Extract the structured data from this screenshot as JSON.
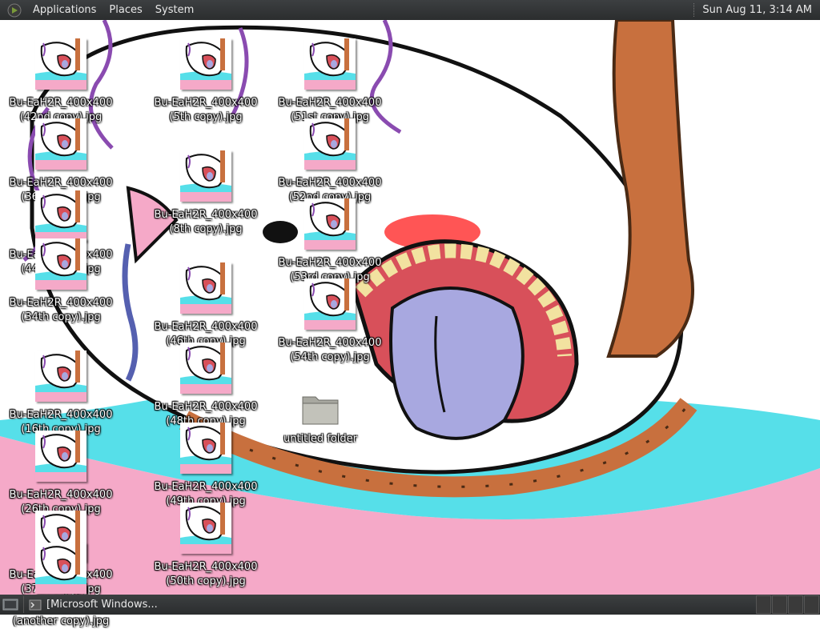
{
  "top_panel": {
    "menus": [
      "Applications",
      "Places",
      "System"
    ],
    "clock": "Sun Aug 11,  3:14 AM"
  },
  "bottom_panel": {
    "task_label": "[Microsoft Windows..."
  },
  "desktop": {
    "left_icons": [
      {
        "line1": "Bu-EaH2R_400x400",
        "line2": "(42nd copy).jpg"
      },
      {
        "line1": "Bu-EaH2R_400x400",
        "line2": "(36th copy).jpg"
      },
      {
        "line1": "Bu-EaH2R_400x400",
        "line2": "(44th copy).jpg"
      },
      {
        "line1": "Bu-EaH2R_400x400",
        "line2": "(34th copy).jpg"
      },
      {
        "line1": "Bu-EaH2R_400x400",
        "line2": "(16th copy).jpg"
      },
      {
        "line1": "Bu-EaH2R_400x400",
        "line2": "(26th copy).jpg"
      },
      {
        "line1": "Bu-EaH2R_400x400",
        "line2": "(37th copy).jpg"
      },
      {
        "line1": "Bu-EaH2R_400x400",
        "line2": "(another copy).jpg"
      }
    ],
    "middle_icons": [
      {
        "line1": "Bu-EaH2R_400x400",
        "line2": "(5th copy).jpg"
      },
      {
        "line1": "Bu-EaH2R_400x400",
        "line2": "(8th copy).jpg"
      },
      {
        "line1": "Bu-EaH2R_400x400",
        "line2": "(46th copy).jpg"
      },
      {
        "line1": "Bu-EaH2R_400x400",
        "line2": "(48th copy).jpg"
      },
      {
        "line1": "Bu-EaH2R_400x400",
        "line2": "(49th copy).jpg"
      },
      {
        "line1": "Bu-EaH2R_400x400",
        "line2": "(50th copy).jpg"
      }
    ],
    "right_icons": [
      {
        "line1": "Bu-EaH2R_400x400",
        "line2": "(51st copy).jpg"
      },
      {
        "line1": "Bu-EaH2R_400x400",
        "line2": "(52nd copy).jpg"
      },
      {
        "line1": "Bu-EaH2R_400x400",
        "line2": "(53rd copy).jpg"
      },
      {
        "line1": "Bu-EaH2R_400x400",
        "line2": "(54th copy).jpg"
      }
    ],
    "folder": {
      "label": "untitled folder"
    }
  },
  "colors": {
    "panel": "#2f3133",
    "wallpaper_pink": "#f5a9c8",
    "wallpaper_cyan": "#56dfe9",
    "rope_brown": "#c8703e",
    "tongue": "#a8a8e0"
  }
}
